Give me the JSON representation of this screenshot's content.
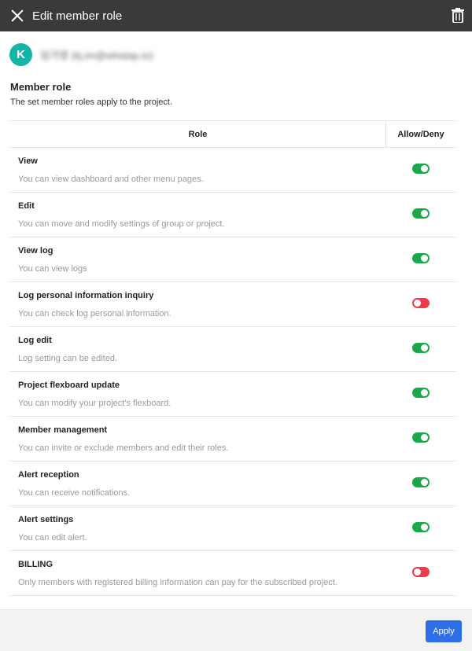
{
  "header": {
    "title": "Edit member role",
    "close_icon": "close-icon",
    "delete_icon": "trash-icon"
  },
  "user": {
    "avatar_letter": "K",
    "name": "임가영 (kj.im@whatap.io)"
  },
  "section": {
    "title": "Member role",
    "description": "The set member roles apply to the project."
  },
  "table": {
    "columns": {
      "role": "Role",
      "allow": "Allow/Deny"
    },
    "rows": [
      {
        "name": "View",
        "description": "You can view dashboard and other menu pages.",
        "allowed": true
      },
      {
        "name": "Edit",
        "description": "You can move and modify settings of group or project.",
        "allowed": true
      },
      {
        "name": "View log",
        "description": "You can view logs",
        "allowed": true
      },
      {
        "name": "Log personal information inquiry",
        "description": "You can check log personal information.",
        "allowed": false
      },
      {
        "name": "Log edit",
        "description": "Log setting can be edited.",
        "allowed": true
      },
      {
        "name": "Project flexboard update",
        "description": "You can modify your project's flexboard.",
        "allowed": true
      },
      {
        "name": "Member management",
        "description": "You can invite or exclude members and edit their roles.",
        "allowed": true
      },
      {
        "name": "Alert reception",
        "description": "You can receive notifications.",
        "allowed": true
      },
      {
        "name": "Alert settings",
        "description": "You can edit alert.",
        "allowed": true
      },
      {
        "name": "BILLING",
        "description": "Only members with registered billing information can pay for the subscribed project.",
        "allowed": false
      }
    ]
  },
  "footer": {
    "apply_label": "Apply"
  },
  "colors": {
    "header_bg": "#3a3a3a",
    "avatar_bg": "#12b5a8",
    "toggle_on": "#1aa84a",
    "toggle_off": "#ef3b4a",
    "apply_button": "#2c6fe6"
  }
}
